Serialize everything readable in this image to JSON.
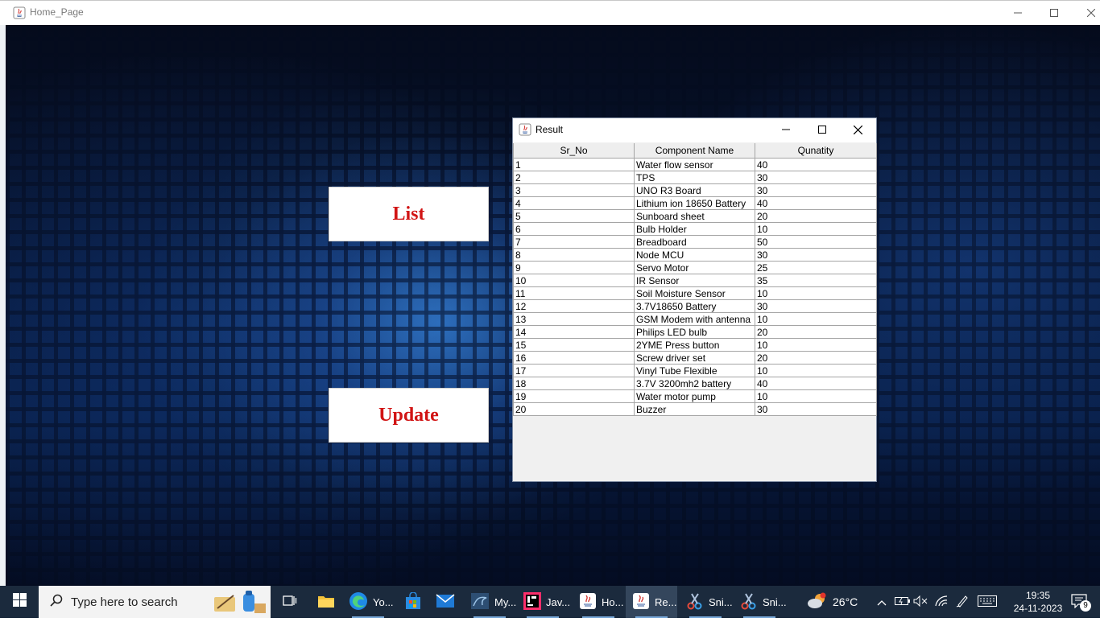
{
  "main_window": {
    "title": "Home_Page",
    "list_button_label": "List",
    "update_button_label": "Update"
  },
  "result_window": {
    "title": "Result",
    "columns": [
      "Sr_No",
      "Component Name",
      "Qunatity"
    ],
    "rows": [
      [
        "1",
        "Water flow sensor",
        "40"
      ],
      [
        "2",
        "TPS",
        "30"
      ],
      [
        "3",
        "UNO R3 Board",
        "30"
      ],
      [
        "4",
        "Lithium ion 18650 Battery",
        "40"
      ],
      [
        "5",
        "Sunboard sheet",
        "20"
      ],
      [
        "6",
        "Bulb Holder",
        "10"
      ],
      [
        "7",
        "Breadboard",
        "50"
      ],
      [
        "8",
        "Node MCU",
        "30"
      ],
      [
        "9",
        "Servo Motor",
        "25"
      ],
      [
        "10",
        "IR Sensor",
        "35"
      ],
      [
        "11",
        "Soil Moisture Sensor",
        "10"
      ],
      [
        "12",
        "3.7V18650 Battery",
        "30"
      ],
      [
        "13",
        "GSM Modem with antenna",
        "10"
      ],
      [
        "14",
        "Philips LED bulb",
        "20"
      ],
      [
        "15",
        "2YME Press button",
        "10"
      ],
      [
        "16",
        "Screw driver set",
        "20"
      ],
      [
        "17",
        "Vinyl Tube Flexible",
        "10"
      ],
      [
        "18",
        "3.7V 3200mh2 battery",
        "40"
      ],
      [
        "19",
        "Water motor pump",
        "10"
      ],
      [
        "20",
        "Buzzer",
        "30"
      ]
    ]
  },
  "taskbar": {
    "search_placeholder": "Type here to search",
    "apps": [
      {
        "icon": "task-view-icon",
        "label": ""
      },
      {
        "icon": "file-explorer-icon",
        "label": ""
      },
      {
        "icon": "edge-icon",
        "label": "Yo..."
      },
      {
        "icon": "store-icon",
        "label": ""
      },
      {
        "icon": "mail-icon",
        "label": ""
      },
      {
        "icon": "mysql-icon",
        "label": "My..."
      },
      {
        "icon": "intellij-icon",
        "label": "Jav..."
      },
      {
        "icon": "java-icon",
        "label": "Ho..."
      },
      {
        "icon": "java-icon",
        "label": "Re..."
      },
      {
        "icon": "snipping-tool-icon",
        "label": "Sni..."
      },
      {
        "icon": "snipping-tool-icon",
        "label": "Sni..."
      }
    ],
    "weather": "26°C",
    "time": "19:35",
    "date": "24-11-2023",
    "notification_count": "9"
  }
}
